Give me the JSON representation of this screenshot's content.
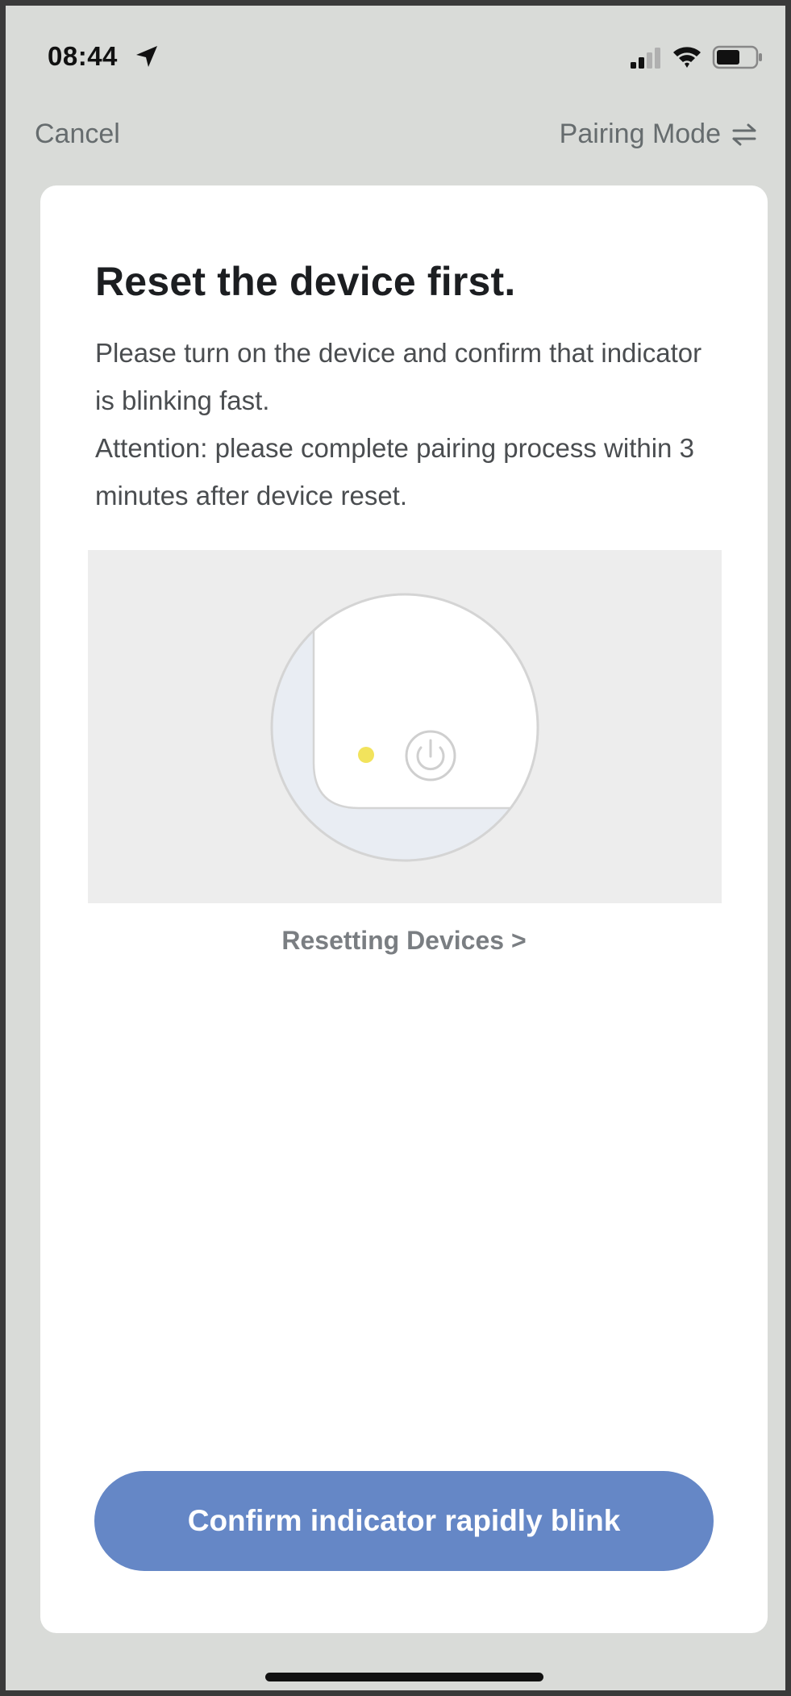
{
  "status_bar": {
    "time": "08:44"
  },
  "nav": {
    "cancel_label": "Cancel",
    "pairing_mode_label": "Pairing Mode"
  },
  "content": {
    "title": "Reset the device first.",
    "description_line1": "Please turn on the device and confirm that indicator is blinking fast.",
    "description_line2": "Attention: please complete pairing process within 3 minutes after device reset.",
    "reset_link_label": "Resetting Devices >"
  },
  "confirm_button_label": "Confirm indicator rapidly blink",
  "colors": {
    "accent": "#6587c6",
    "indicator_light": "#f2e35c",
    "background": "#d9dbd8"
  },
  "icons": {
    "location": "location-arrow-icon",
    "signal": "cellular-signal-icon",
    "wifi": "wifi-icon",
    "battery": "battery-icon",
    "pairing_mode": "switch-arrows-icon",
    "power": "power-icon"
  }
}
